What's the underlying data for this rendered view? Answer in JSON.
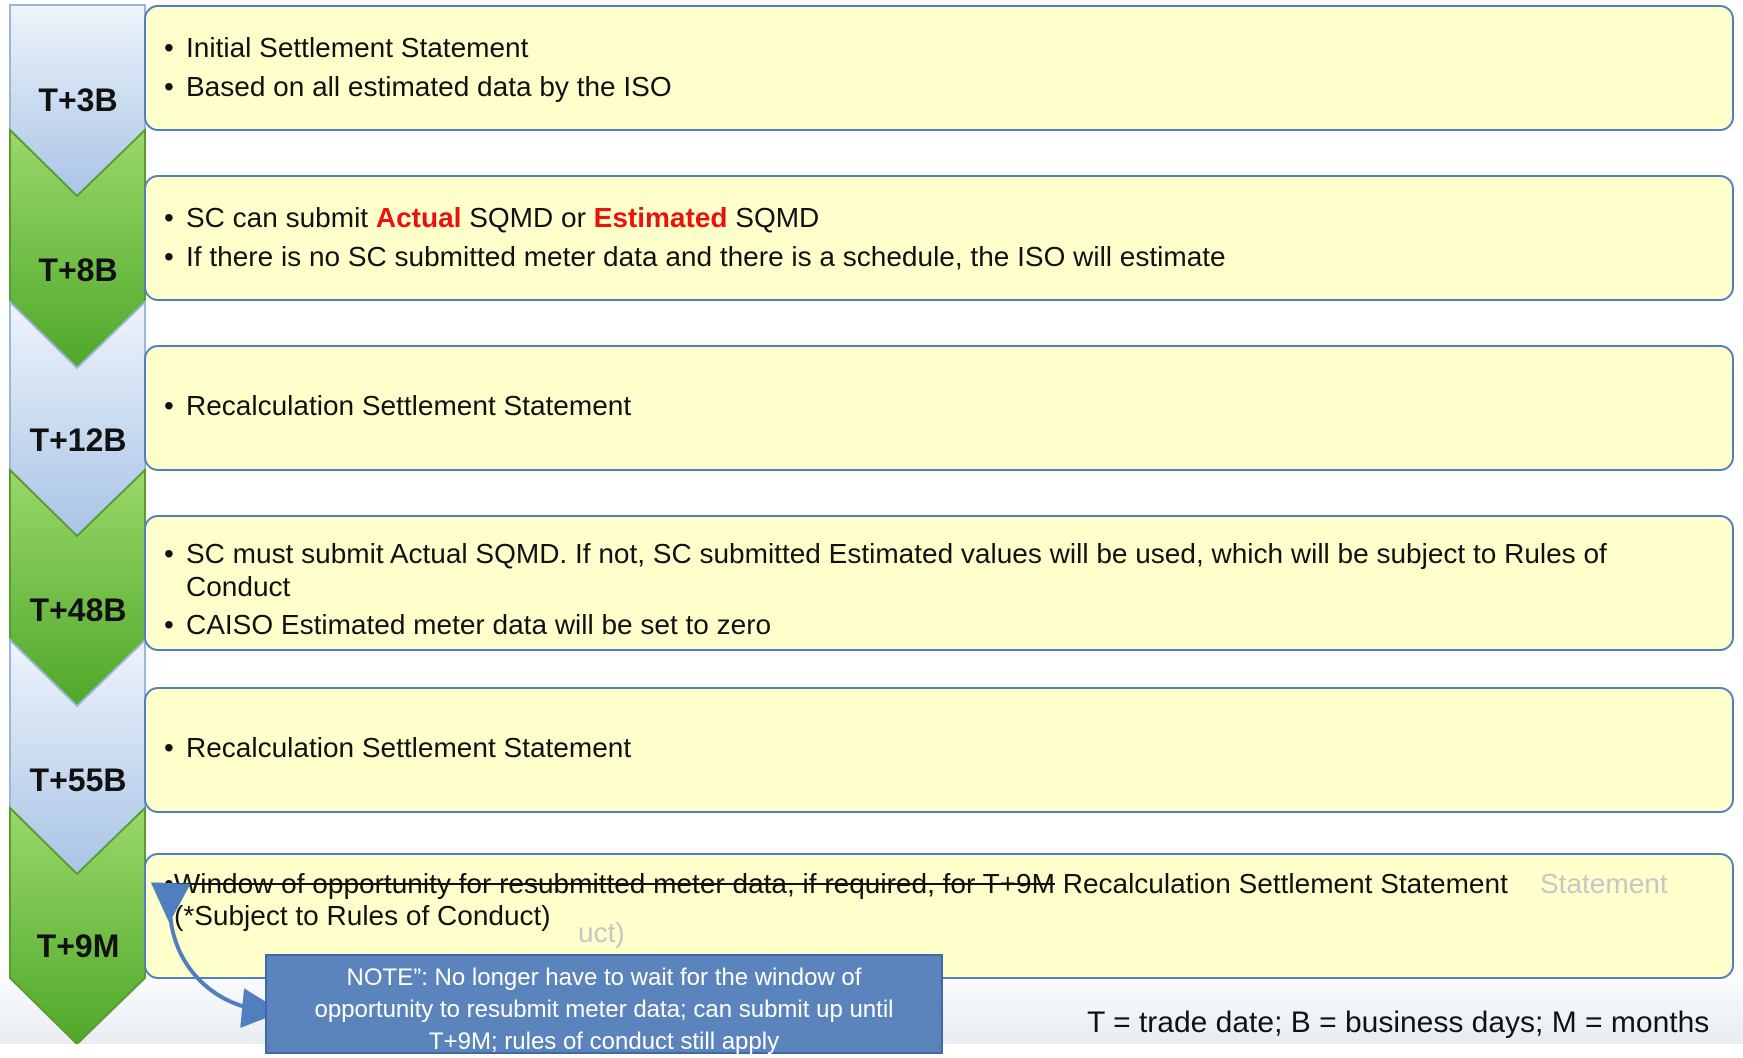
{
  "rows": [
    {
      "label": "T+3B",
      "style": "blue",
      "bullets": [
        "Initial Settlement Statement",
        "Based on all estimated data by the ISO"
      ]
    },
    {
      "label": "T+8B",
      "style": "green",
      "bullet1": {
        "a": "SC can submit ",
        "b": "Actual",
        "c": " SQMD or ",
        "d": "Estimated",
        "e": " SQMD"
      },
      "bullets": [
        "If there is no SC submitted meter data and there is a schedule, the ISO will estimate"
      ]
    },
    {
      "label": "T+12B",
      "style": "blue",
      "bullets": [
        "Recalculation Settlement Statement"
      ]
    },
    {
      "label": "T+48B",
      "style": "green",
      "bullets": [
        "SC must submit Actual SQMD. If not, SC submitted Estimated values will be used, which will be subject to Rules of Conduct",
        "CAISO Estimated meter data will be set to zero"
      ]
    },
    {
      "label": "T+55B",
      "style": "blue",
      "bullets": [
        "Recalculation Settlement Statement"
      ]
    },
    {
      "label": "T+9M",
      "style": "green",
      "struck_text": "Window of opportunity for resubmitted meter data, if required, for T+9M",
      "line_end": " Recalculation Settlement Statement",
      "ghost_end": "Statement",
      "subject_text": "(*Subject to Rules of Conduct)",
      "ghost_subject": "uct)"
    }
  ],
  "note": "NOTE”: No longer have to wait for the window of opportunity to resubmit meter data; can submit up until T+9M; rules of conduct still apply",
  "legend": "T = trade date; B = business days; M = months",
  "colors": {
    "blue_chevron": "#c5d9f1",
    "green_chevron": "#6cc33a",
    "box_fill": "#ffffcc",
    "box_border": "#4f7fbe",
    "highlight_red": "#e8130c",
    "note_fill": "#5b84bd"
  }
}
